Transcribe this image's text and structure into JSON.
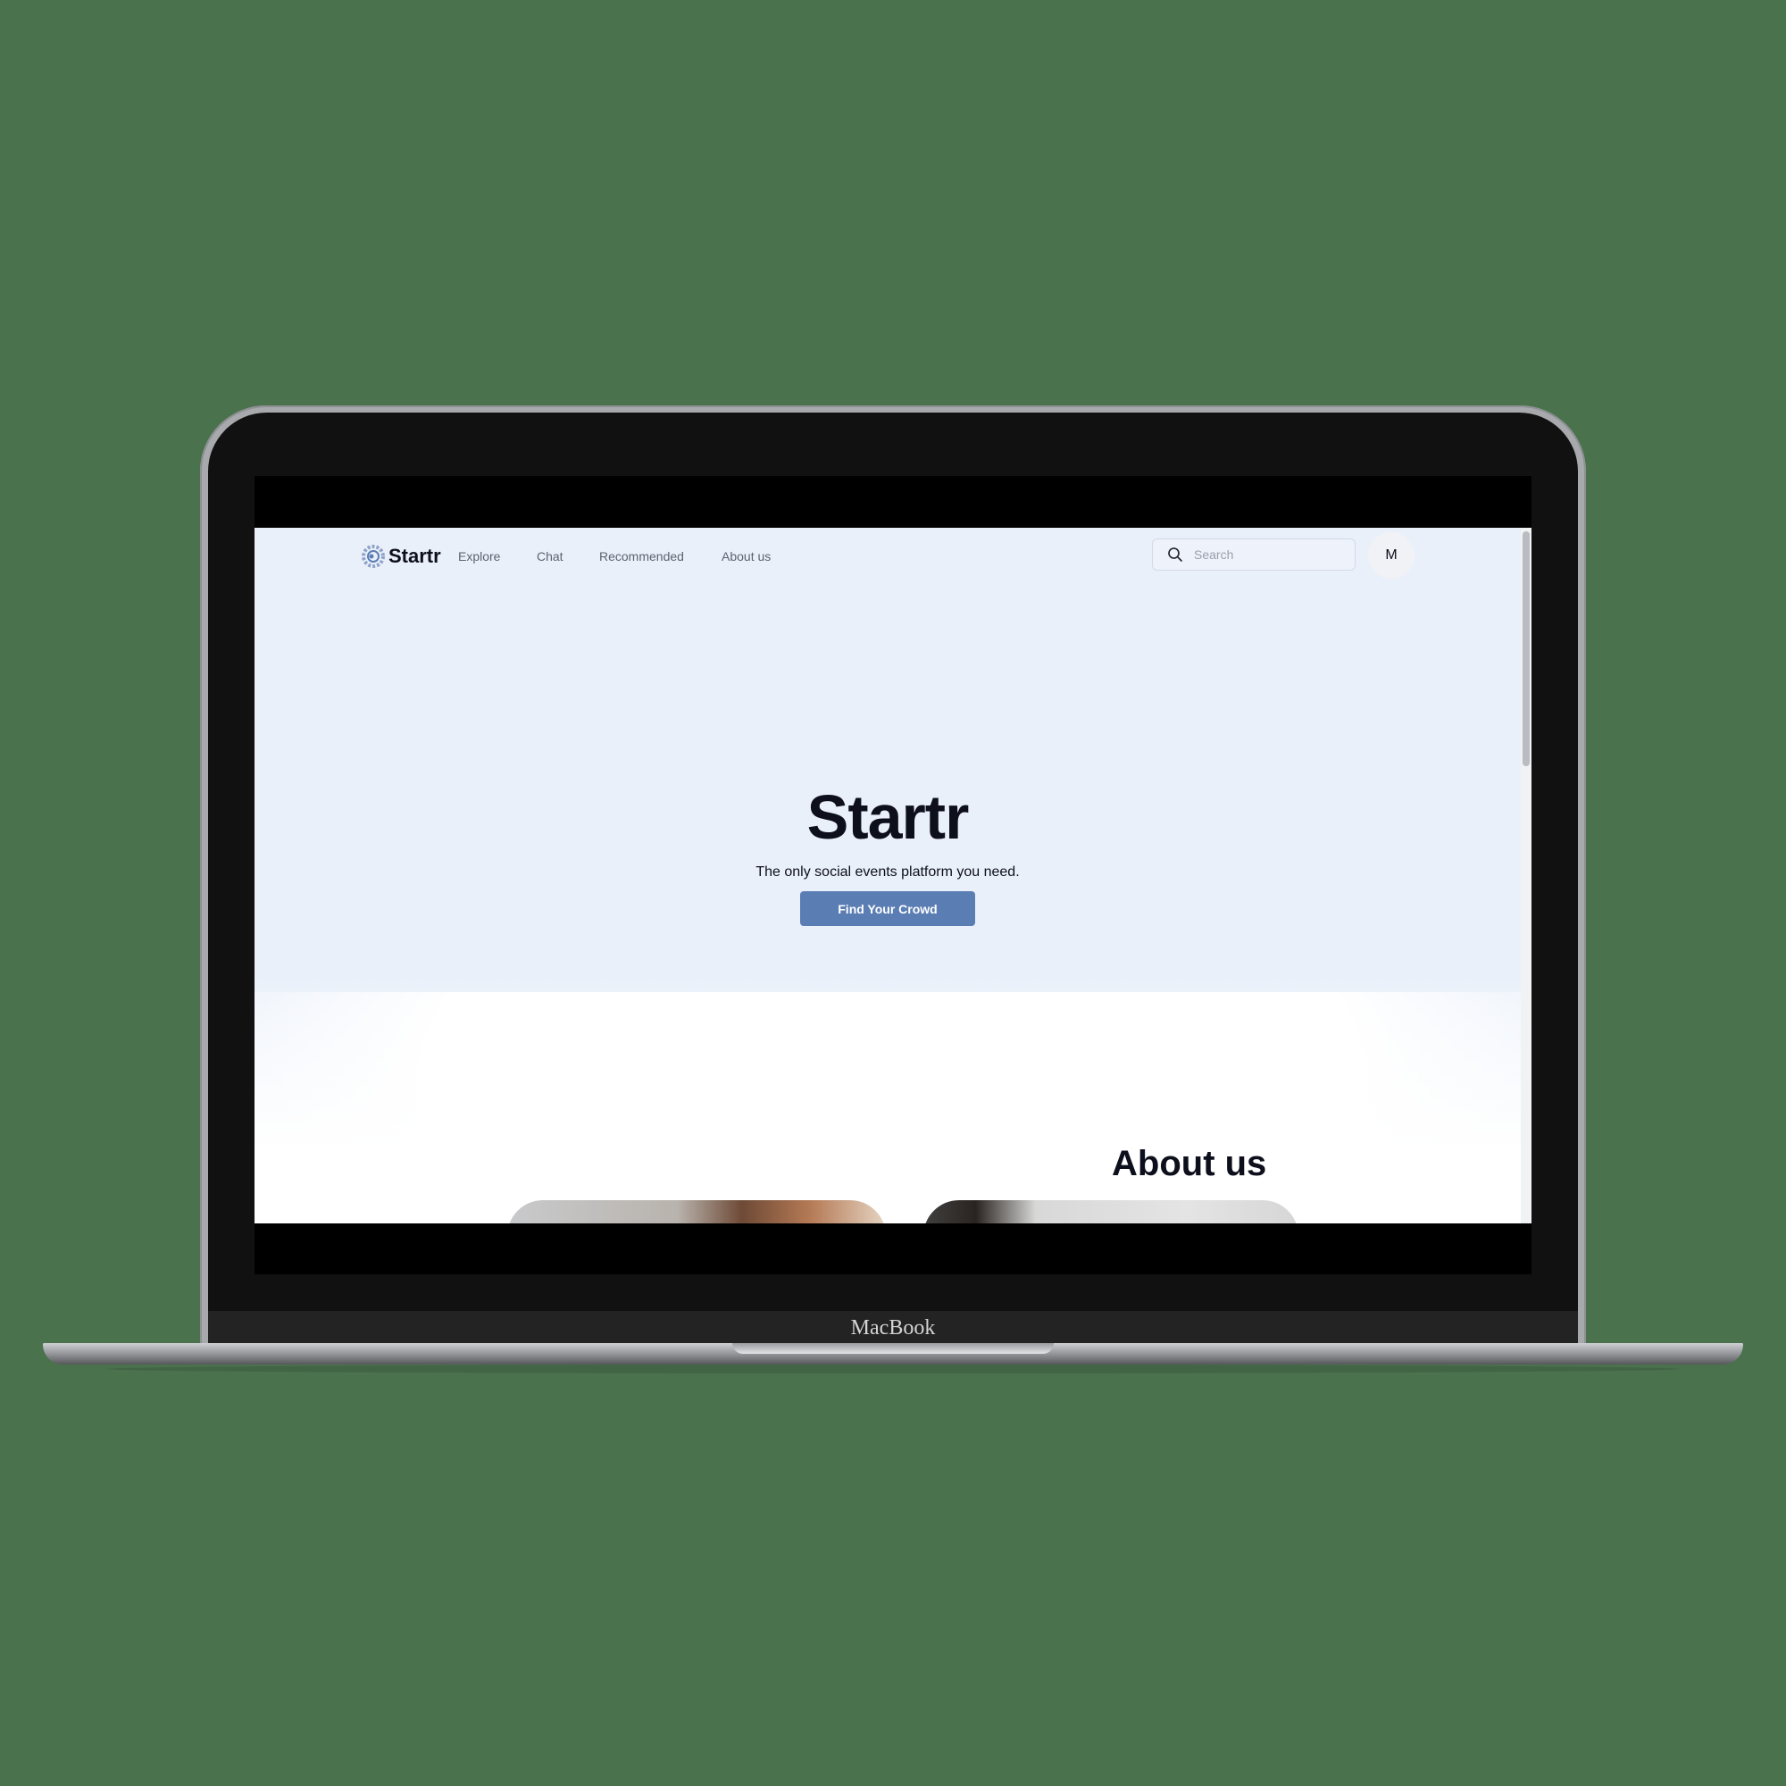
{
  "device": {
    "brand": "MacBook"
  },
  "site": {
    "logo_text": "Startr",
    "nav_links": [
      "Explore",
      "Chat",
      "Recommended",
      "About us"
    ],
    "search": {
      "placeholder": "Search",
      "value": ""
    },
    "avatar_initial": "M"
  },
  "hero": {
    "title": "Startr",
    "subtitle": "The only social events platform you need.",
    "cta_label": "Find Your Crowd"
  },
  "about": {
    "title": "About us"
  },
  "colors": {
    "accent": "#5a7db4",
    "hero_bg": "#eaf0fa",
    "text": "#0d0f1c"
  },
  "icons": [
    "startr-logo-icon",
    "search-icon"
  ]
}
